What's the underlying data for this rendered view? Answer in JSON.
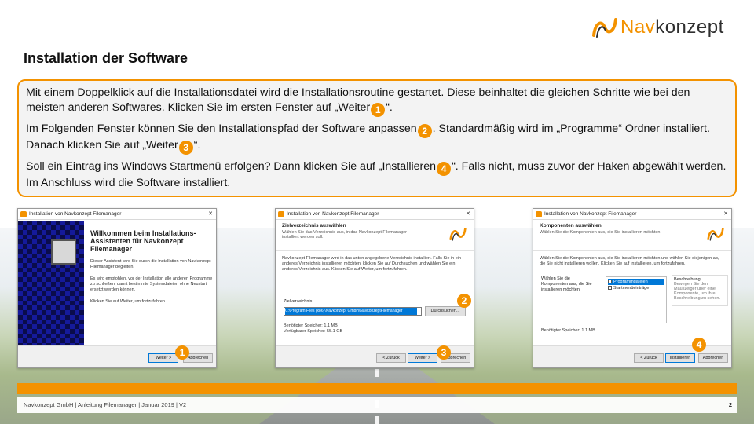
{
  "logo": {
    "brand_a": "Nav",
    "brand_b": "konzept"
  },
  "page": {
    "title": "Installation der Software"
  },
  "intro": {
    "p1": [
      "Mit einem Doppelklick auf die Installationsdatei wird die Installationsroutine gestartet. Diese beinhaltet die gleichen Schritte wie bei den meisten anderen Softwares. Klicken Sie im ersten Fenster auf „Weiter",
      "“."
    ],
    "p2": [
      "Im Folgenden Fenster können Sie den Installationspfad der Software anpassen",
      ". Standardmäßig wird im „Programme“ Ordner installiert. Danach klicken Sie auf „Weiter",
      "“."
    ],
    "p3": [
      "Soll ein Eintrag ins Windows Startmenü erfolgen? Dann klicken Sie auf „Installieren",
      "“. Falls nicht, muss zuvor der Haken abgewählt werden. Im Anschluss wird die Software installiert."
    ],
    "badges": [
      "1",
      "2",
      "3",
      "4"
    ]
  },
  "screenshots": [
    {
      "window_title": "Installation von Navkonzept Filemanager",
      "welcome_title": "Willkommen beim Installations-Assistenten für Navkonzept Filemanager",
      "text1": "Dieser Assistent wird Sie durch die Installation von Navkonzept Filemanager begleiten.",
      "text2": "Es wird empfohlen, vor der Installation alle anderen Programme zu schließen, damit bestimmte Systemdateien ohne Neustart ersetzt werden können.",
      "text3": "Klicken Sie auf Weiter, um fortzufahren.",
      "next": "Weiter >",
      "cancel": "Abbrechen",
      "badge": "1"
    },
    {
      "window_title": "Installation von Navkonzept Filemanager",
      "header_title": "Zielverzeichnis auswählen",
      "header_sub": "Wählen Sie das Verzeichnis aus, in das Navkonzept Filemanager installiert werden soll.",
      "body": "Navkonzept Filemanager wird in das unten angegebene Verzeichnis installiert. Falls Sie in ein anderes Verzeichnis installieren möchten, klicken Sie auf Durchsuchen und wählen Sie ein anderes Verzeichnis aus. Klicken Sie auf Weiter, um fortzufahren.",
      "dir_label": "Zielverzeichnis",
      "dir_value": "C:\\Program Files (x86)\\Navkonzept GmbH\\NavkonzeptFilemanager",
      "browse": "Durchsuchen...",
      "space_needed": "Benötigter Speicher: 1.1 MB",
      "space_free": "Verfügbarer Speicher: 55.1 GB",
      "back": "< Zurück",
      "next": "Weiter >",
      "cancel": "Abbrechen",
      "badge_dir": "2",
      "badge_next": "3"
    },
    {
      "window_title": "Installation von Navkonzept Filemanager",
      "header_title": "Komponenten auswählen",
      "header_sub": "Wählen Sie die Komponenten aus, die Sie installieren möchten.",
      "body": "Wählen Sie die Komponenten aus, die Sie installieren möchten und wählen Sie diejenigen ab, die Sie nicht installieren wollen. Klicken Sie auf Installieren, um fortzufahren.",
      "comp_label": "Wählen Sie die Komponenten aus, die Sie installieren möchten:",
      "components": [
        "Programmdateien",
        "Startmenüeinträge"
      ],
      "desc_title": "Beschreibung",
      "desc_text": "Bewegen Sie den Mauszeiger über eine Komponente, um ihre Beschreibung zu sehen.",
      "space_needed": "Benötigter Speicher: 1.1 MB",
      "back": "< Zurück",
      "install": "Installieren",
      "cancel": "Abbrechen",
      "badge": "4"
    }
  ],
  "footer": {
    "text": "Navkonzept GmbH  |  Anleitung Filemanager  |  Januar 2019 | V2",
    "page_number": "2"
  },
  "colors": {
    "accent": "#f39200",
    "selection": "#0078d7"
  }
}
